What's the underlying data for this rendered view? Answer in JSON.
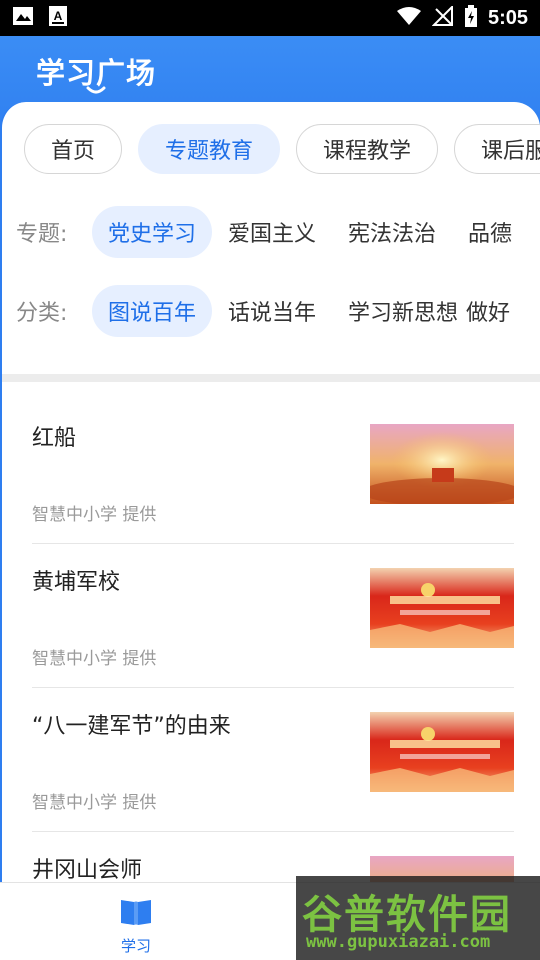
{
  "status_bar": {
    "time": "5:05",
    "icons": [
      "image-icon",
      "font-icon",
      "wifi-icon",
      "no-signal-icon",
      "battery-icon"
    ]
  },
  "header": {
    "title": "学习广场"
  },
  "tabs": [
    {
      "label": "首页",
      "active": false
    },
    {
      "label": "专题教育",
      "active": true
    },
    {
      "label": "课程教学",
      "active": false
    },
    {
      "label": "课后服务",
      "active": false
    }
  ],
  "topic_filter": {
    "label": "专题:",
    "chips": [
      {
        "label": "党史学习",
        "active": true
      },
      {
        "label": "爱国主义",
        "active": false
      },
      {
        "label": "宪法法治",
        "active": false
      },
      {
        "label": "品德",
        "active": false
      }
    ]
  },
  "category_filter": {
    "label": "分类:",
    "chips": [
      {
        "label": "图说百年",
        "active": true
      },
      {
        "label": "话说当年",
        "active": false
      },
      {
        "label": "学习新思想",
        "active": false
      },
      {
        "label": "做好",
        "active": false
      }
    ]
  },
  "items": [
    {
      "title": "红船",
      "source": "智慧中小学 提供",
      "thumb": "sunrise-thumbnail"
    },
    {
      "title": "黄埔军校",
      "source": "智慧中小学 提供",
      "thumb": "red-banner-thumbnail"
    },
    {
      "title": "“八一建军节”的由来",
      "source": "智慧中小学 提供",
      "thumb": "red-banner-thumbnail"
    },
    {
      "title": "井冈山会师",
      "source": "",
      "thumb": "sunrise-thumbnail"
    }
  ],
  "bottom_nav": {
    "learn_label": "学习"
  },
  "watermark": {
    "main": "谷普软件园",
    "sub": "www.gupuxiazai.com"
  },
  "colors": {
    "accent": "#2e7ef0",
    "active_text": "#1f6fe8",
    "active_bg": "#e6efff",
    "watermark": "#7cc242"
  }
}
